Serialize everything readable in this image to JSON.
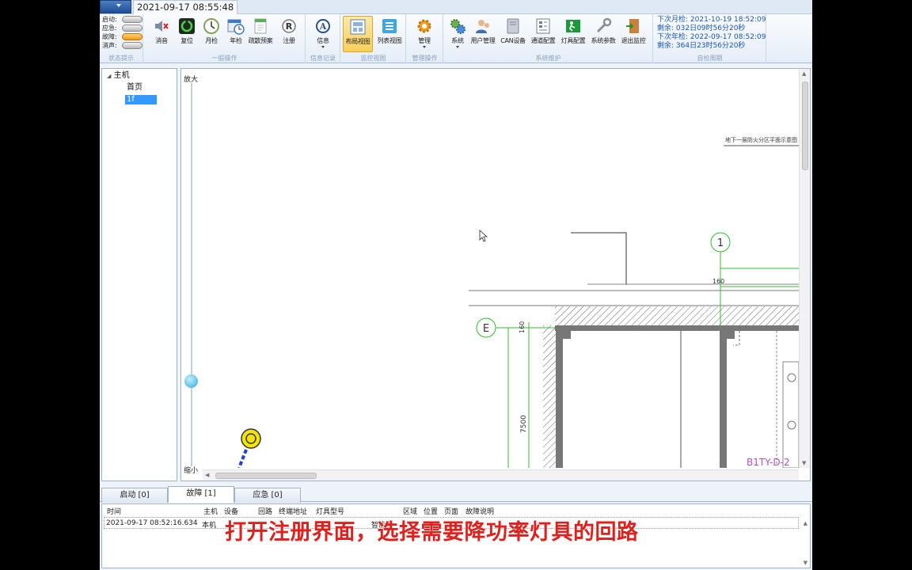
{
  "top_tab": {
    "datetime": "2021-09-17 08:55:48"
  },
  "status_group": {
    "label": "状态提示",
    "rows": [
      {
        "label": "启动:",
        "color": "#c8c8c8"
      },
      {
        "label": "应急:",
        "color": "#c8c8c8"
      },
      {
        "label": "故障:",
        "color": "#f0a020"
      },
      {
        "label": "消声:",
        "color": "#c8c8c8"
      }
    ]
  },
  "general_ops": {
    "label": "一般操作",
    "buttons": [
      {
        "label": "消音",
        "icon": "speaker-mute-icon"
      },
      {
        "label": "复位",
        "icon": "reset-icon"
      },
      {
        "label": "月检",
        "icon": "clock-icon"
      },
      {
        "label": "年检",
        "icon": "calendar-clock-icon"
      },
      {
        "label": "疏散预案",
        "icon": "document-icon"
      },
      {
        "label": "注册",
        "icon": "registered-icon"
      }
    ]
  },
  "info_records": {
    "label": "信息记录",
    "buttons": [
      {
        "label": "信息",
        "icon": "info-pen-icon"
      }
    ]
  },
  "monitor_view": {
    "label": "监控视图",
    "buttons": [
      {
        "label": "布局视图",
        "icon": "layout-view-icon",
        "active": true
      },
      {
        "label": "列表视图",
        "icon": "list-view-icon",
        "active": false
      }
    ]
  },
  "manage_ops": {
    "label": "管理操作",
    "buttons": [
      {
        "label": "管理",
        "icon": "gear-icon"
      }
    ]
  },
  "system_maint": {
    "label": "系统维护",
    "buttons": [
      {
        "label": "系统",
        "icon": "system-gears-icon"
      },
      {
        "label": "用户管理",
        "icon": "users-icon"
      },
      {
        "label": "CAN设备",
        "icon": "can-device-icon"
      },
      {
        "label": "通道配置",
        "icon": "channel-config-icon"
      },
      {
        "label": "灯具配置",
        "icon": "exit-sign-icon"
      },
      {
        "label": "系统参数",
        "icon": "wrench-icon"
      },
      {
        "label": "退出监控",
        "icon": "exit-door-icon"
      }
    ]
  },
  "self_check": {
    "label": "自检周期",
    "lines": [
      "下次月检: 2021-10-19 18:52:09",
      "剩余: 032日09时56分20秒",
      "下次年检: 2022-09-17 08:52:09",
      "剩余: 364日23时56分20秒"
    ]
  },
  "tree": {
    "root": "主机",
    "children": [
      "首页",
      "1f"
    ],
    "selected": "1f"
  },
  "canvas": {
    "zoom_in_label": "放大",
    "zoom_out_label": "缩小",
    "drawing_title": "地下一层防火分区平面示意图",
    "axis_1": "1",
    "axis_e": "E",
    "dim_160_h": "160",
    "dim_160_v": "160",
    "dim_7500": "7500",
    "light_tag": "B1TY-D-2"
  },
  "bottom_tabs": [
    {
      "label": "启动 [0]",
      "active": false
    },
    {
      "label": "故障 [1]",
      "active": true
    },
    {
      "label": "应急 [0]",
      "active": false
    }
  ],
  "fault_table": {
    "columns": [
      "时间",
      "主机",
      "设备",
      "回路",
      "终端地址",
      "灯具型号",
      "区域",
      "位置",
      "页面",
      "故障说明"
    ],
    "rows": [
      {
        "time": "2021-09-17 08:52:16.634",
        "host": "本机",
        "model": "智能型"
      }
    ]
  },
  "subtitle": "打开注册界面，选择需要降功率灯具的回路"
}
